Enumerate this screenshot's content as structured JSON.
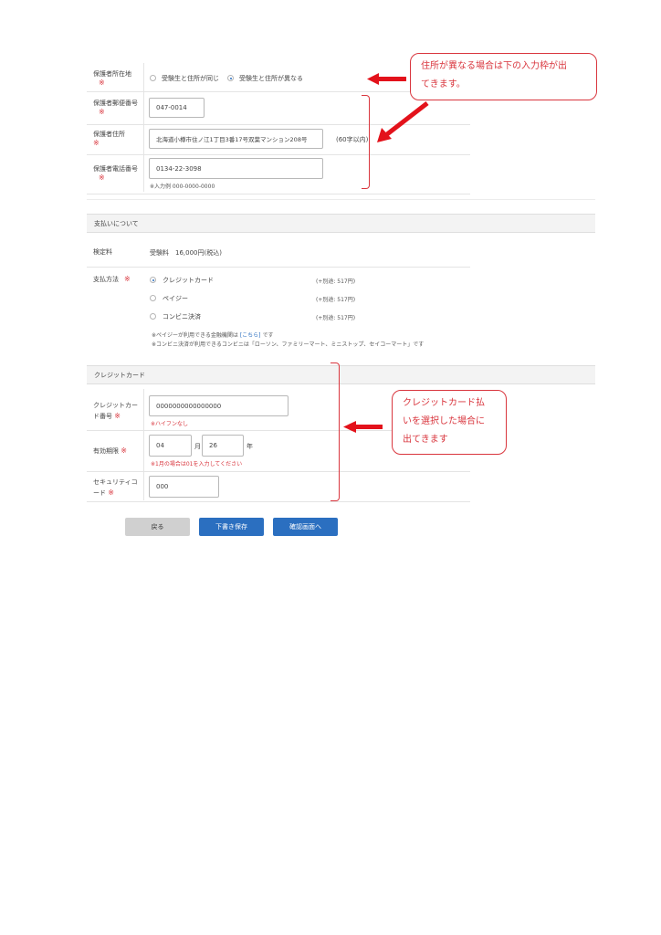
{
  "guardian": {
    "address_location": {
      "label": "保護者所在地",
      "options": [
        "受験生と住所が同じ",
        "受験生と住所が異なる"
      ],
      "selected_index": 1
    },
    "postal_code": {
      "label": "保護者郵便番号",
      "value": "047-0014"
    },
    "address": {
      "label": "保護者住所",
      "value": "北海道小樽市住ノ江1丁目3番17号双葉マンション208号",
      "note": "(60字以内)"
    },
    "phone": {
      "label": "保護者電話番号",
      "value": "0134-22-3098",
      "hint": "※入力例 000-0000-0000"
    }
  },
  "required_mark": "※",
  "payment": {
    "section_title": "支払いについて",
    "fee_label": "検定料",
    "fee_value": "受験料　16,000円(税込)",
    "method_label": "支払方法",
    "methods": [
      {
        "label": "クレジットカード",
        "fee": "(+別途: 517円)"
      },
      {
        "label": "ペイジー",
        "fee": "(+別途: 517円)"
      },
      {
        "label": "コンビニ決済",
        "fee": "(+別途: 517円)"
      }
    ],
    "selected_method_index": 0,
    "note1_prefix": "※ペイジーが利用できる金融機関は",
    "note1_link": "[こちら]",
    "note1_suffix": "です",
    "note2": "※コンビニ決済が利用できるコンビニは「ローソン、ファミリーマート、ミニストップ、セイコーマート」です"
  },
  "credit_card": {
    "section_title": "クレジットカード",
    "number_label_1": "クレジットカー",
    "number_label_2": "ド番号",
    "number_value": "0000000000000000",
    "number_hint": "※ハイフンなし",
    "expiry_label": "有効期限",
    "expiry_month": "04",
    "expiry_month_unit": "月",
    "expiry_year": "26",
    "expiry_year_unit": "年",
    "expiry_hint": "※1月の場合は01を入力してください",
    "security_label_1": "セキュリティコ",
    "security_label_2": "ード",
    "security_value": "000"
  },
  "buttons": {
    "back": "戻る",
    "save_draft": "下書き保存",
    "confirm": "確認画面へ"
  },
  "annotations": {
    "address_callout_line1": "住所が異なる場合は下の入力枠が出",
    "address_callout_line2": "てきます。",
    "card_callout_line1": "クレジットカード払",
    "card_callout_line2": "いを選択した場合に",
    "card_callout_line3": "出てきます"
  },
  "colors": {
    "accent": "#2b6fc0",
    "required": "#d9363e",
    "annotation": "#e3121b",
    "back_button": "#d0d0d0"
  }
}
